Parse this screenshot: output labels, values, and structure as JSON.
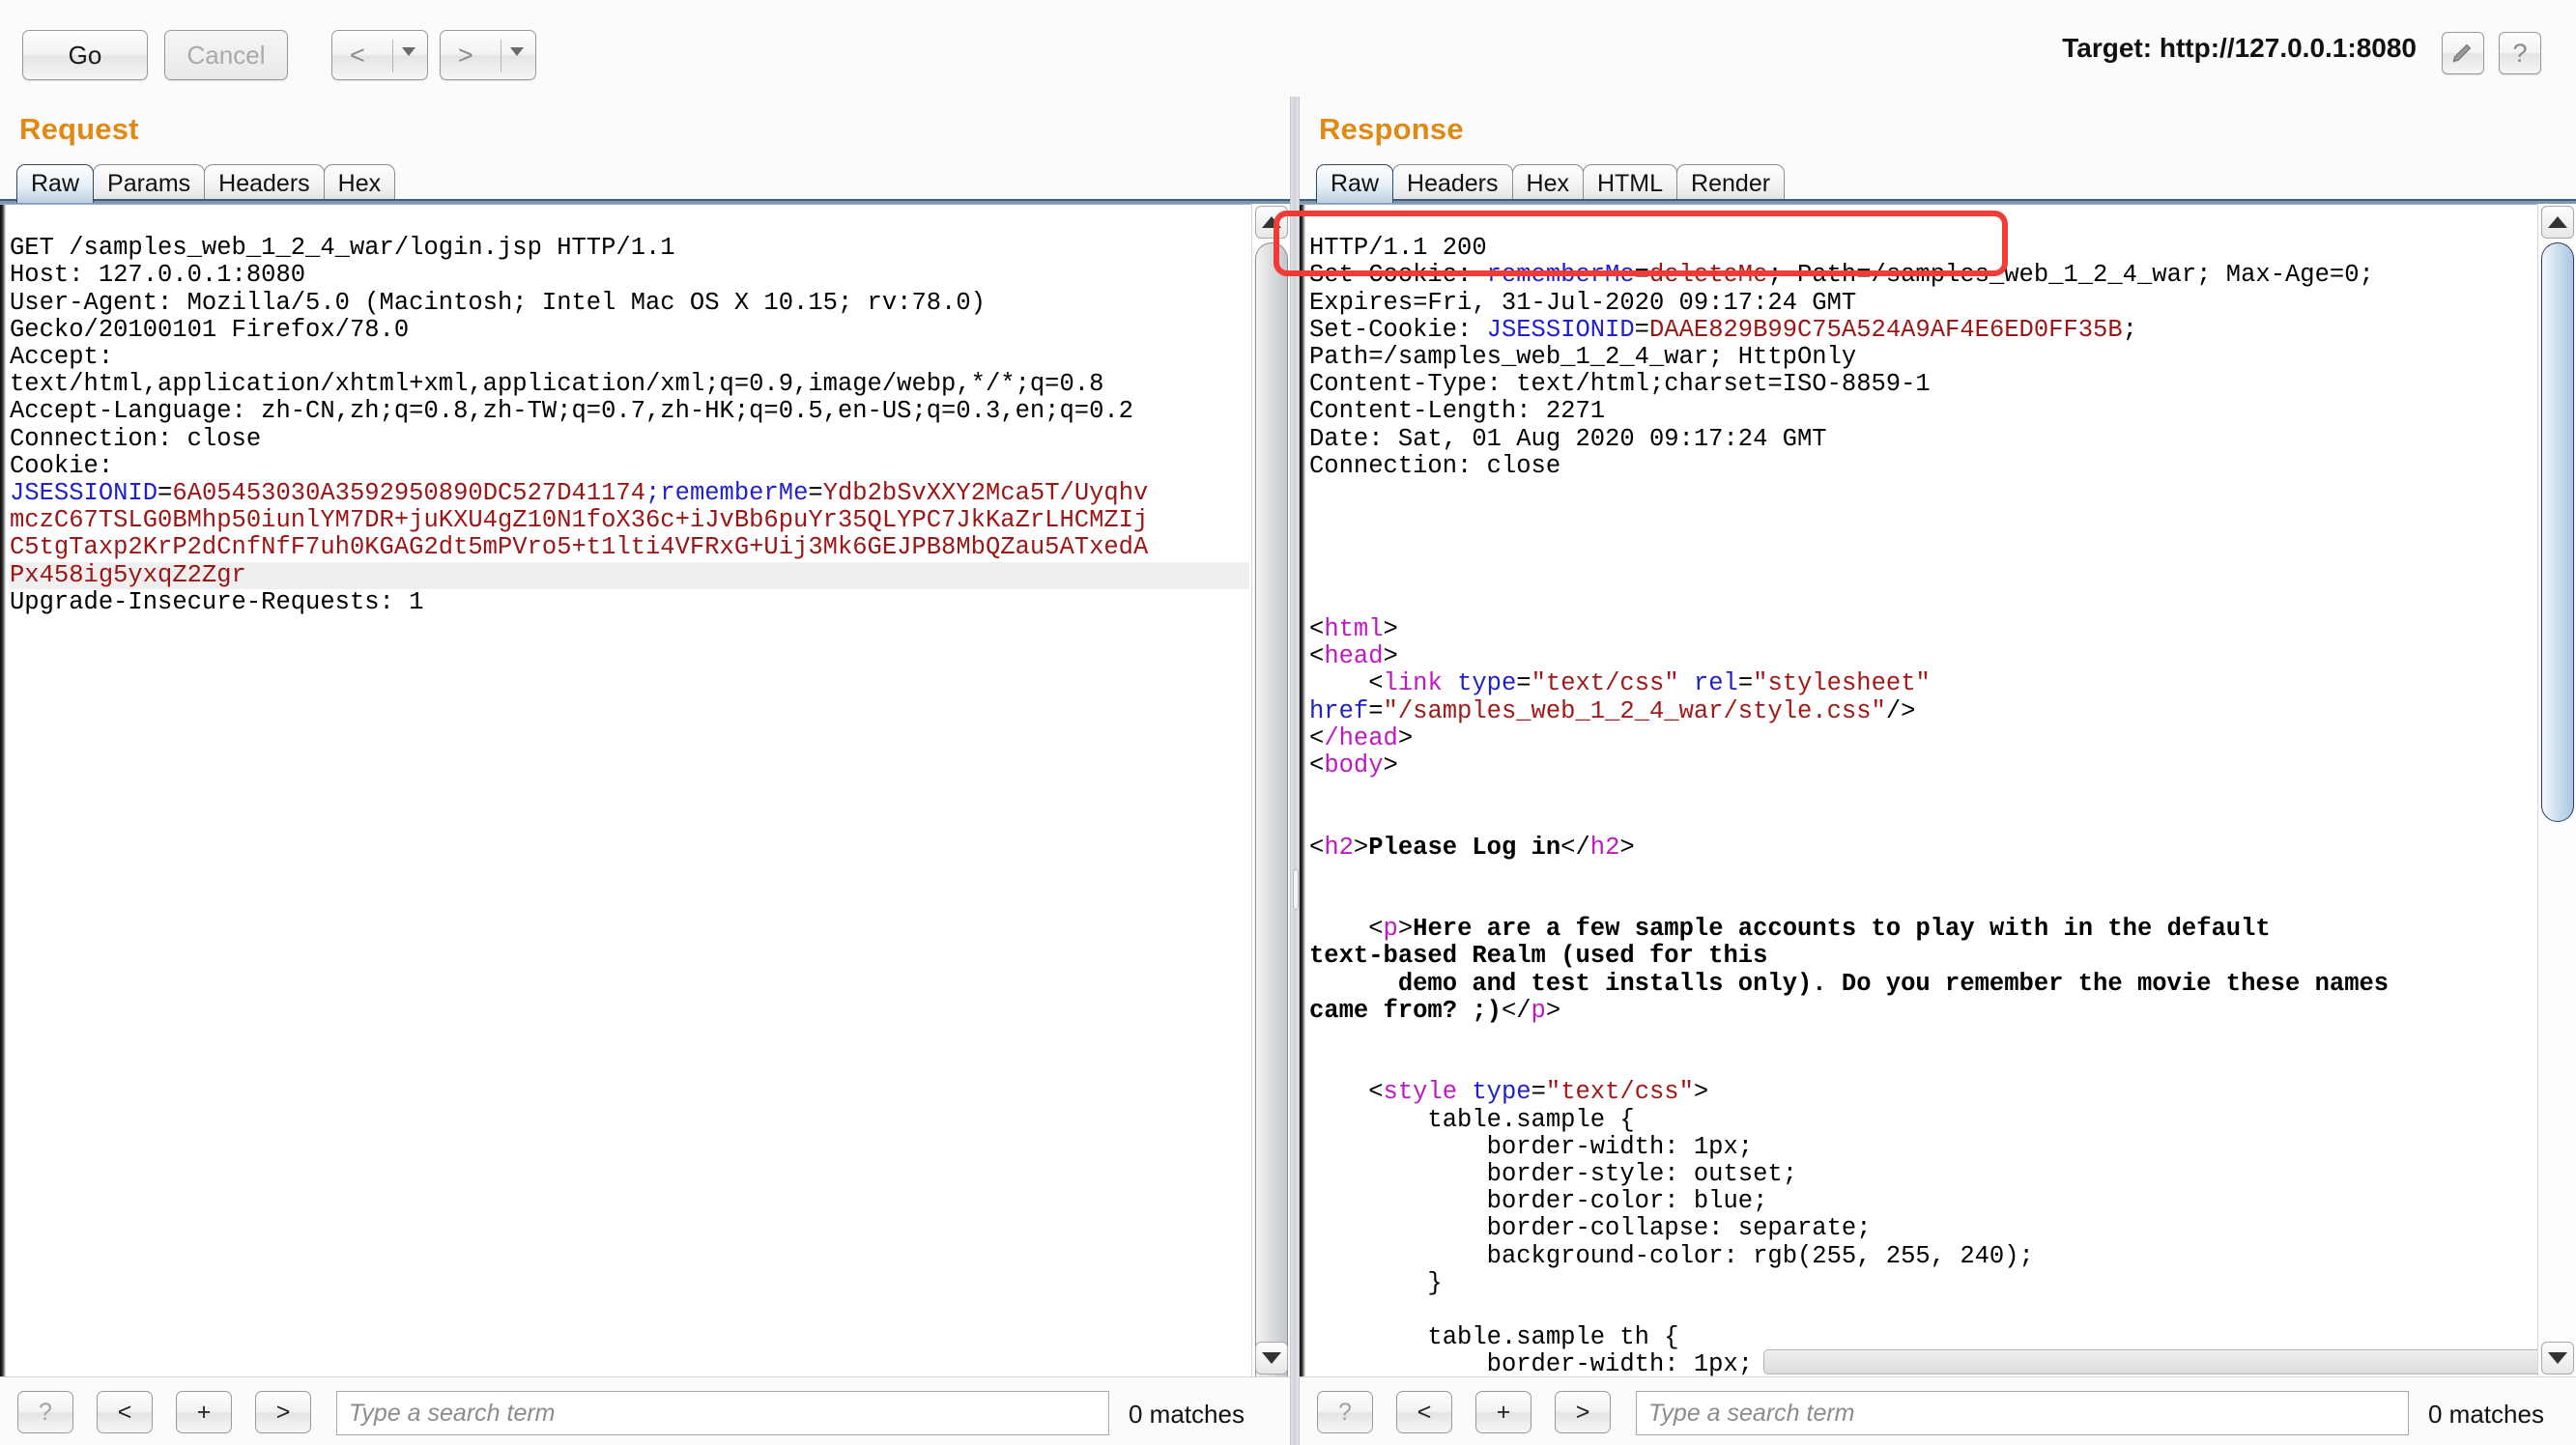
{
  "toolbar": {
    "go_label": "Go",
    "cancel_label": "Cancel",
    "back_label": "<",
    "forward_label": ">",
    "target_label": "Target: http://127.0.0.1:8080",
    "pencil_icon": "pencil-icon",
    "help_icon": "question-mark-icon"
  },
  "request": {
    "title": "Request",
    "tabs": [
      {
        "label": "Raw",
        "active": true
      },
      {
        "label": "Params",
        "active": false
      },
      {
        "label": "Headers",
        "active": false
      },
      {
        "label": "Hex",
        "active": false
      }
    ],
    "lines": [
      {
        "text": "GET /samples_web_1_2_4_war/login.jsp HTTP/1.1"
      },
      {
        "text": "Host: 127.0.0.1:8080"
      },
      {
        "text": "User-Agent: Mozilla/5.0 (Macintosh; Intel Mac OS X 10.15; rv:78.0)"
      },
      {
        "text": "Gecko/20100101 Firefox/78.0"
      },
      {
        "text": "Accept:"
      },
      {
        "text": "text/html,application/xhtml+xml,application/xml;q=0.9,image/webp,*/*;q=0.8"
      },
      {
        "text": "Accept-Language: zh-CN,zh;q=0.8,zh-TW;q=0.7,zh-HK;q=0.5,en-US;q=0.3,en;q=0.2"
      },
      {
        "text": "Connection: close"
      },
      {
        "text": "Cookie:"
      }
    ],
    "cookie_jsessionid_name": "JSESSIONID",
    "cookie_jsessionid_value": "6A05453030A3592950890DC527D41174",
    "cookie_rememberme_name": "rememberMe",
    "cookie_rememberme_value_part1": "Ydb2bSvXXY2Mca5T/Uyqhv",
    "cookie_rememberme_value_part2": "mczC67TSLG0BMhp50iunlYM7DR+juKXU4gZ10N1foX36c+iJvBb6puYr35QLYPC7JkKaZrLHCMZIj",
    "cookie_rememberme_value_part3": "C5tgTaxp2KrP2dCnfNfF7uh0KGAG2dt5mPVro5+t1lti4VFRxG+Uij3Mk6GEJPB8MbQZau5ATxedA",
    "cookie_rememberme_value_part4": "Px458ig5yxqZ2Zgr",
    "trailing_line": "Upgrade-Insecure-Requests: 1",
    "search": {
      "help_label": "?",
      "prev_label": "<",
      "add_label": "+",
      "next_label": ">",
      "placeholder": "Type a search term",
      "value": "",
      "matches": "0 matches"
    }
  },
  "response": {
    "title": "Response",
    "tabs": [
      {
        "label": "Raw",
        "active": true
      },
      {
        "label": "Headers",
        "active": false
      },
      {
        "label": "Hex",
        "active": false
      },
      {
        "label": "HTML",
        "active": false
      },
      {
        "label": "Render",
        "active": false
      }
    ],
    "status_line": "HTTP/1.1 200",
    "setcookie1_prefix": "Set-Cookie: ",
    "setcookie1_name": "rememberMe",
    "setcookie1_value": "deleteMe",
    "setcookie1_rest": "; Path=/samples_web_1_2_4_war; Max-Age=0;",
    "setcookie1_expires": "Expires=Fri, 31-Jul-2020 09:17:24 GMT",
    "setcookie2_prefix": "Set-Cookie: ",
    "setcookie2_name": "JSESSIONID",
    "setcookie2_value": "DAAE829B99C75A524A9AF4E6ED0FF35B",
    "setcookie2_rest": "Path=/samples_web_1_2_4_war; HttpOnly",
    "headers": [
      "Content-Type: text/html;charset=ISO-8859-1",
      "Content-Length: 2271",
      "Date: Sat, 01 Aug 2020 09:17:24 GMT",
      "Connection: close"
    ],
    "body": {
      "tag_html_open": "html",
      "tag_head_open": "head",
      "link_tag": "link",
      "link_attr_type": "type",
      "link_val_type": "\"text/css\"",
      "link_attr_rel": "rel",
      "link_val_rel": "\"stylesheet\"",
      "link_attr_href": "href",
      "link_val_href": "\"/samples_web_1_2_4_war/style.css\"",
      "tag_head_close": "/head",
      "tag_body_open": "body",
      "h2_tag": "h2",
      "h2_text": "Please Log in",
      "p_tag": "p",
      "p_text_line1": "Here are a few sample accounts to play with in the default",
      "p_text_line2": "text-based Realm (used for this",
      "p_text_line3": "demo and test installs only). Do you remember the movie these names",
      "p_text_line4": "came from? ;)",
      "style_tag": "style",
      "style_attr_type": "type",
      "style_val_type": "\"text/css\"",
      "css_lines": [
        "        table.sample {",
        "            border-width: 1px;",
        "            border-style: outset;",
        "            border-color: blue;",
        "            border-collapse: separate;",
        "            background-color: rgb(255, 255, 240);",
        "        }",
        "",
        "        table.sample th {",
        "            border-width: 1px;"
      ]
    },
    "search": {
      "help_label": "?",
      "prev_label": "<",
      "add_label": "+",
      "next_label": ">",
      "placeholder": "Type a search term",
      "value": "",
      "matches": "0 matches"
    }
  },
  "annotation": {
    "highlight_box_color": "#f03b36"
  }
}
